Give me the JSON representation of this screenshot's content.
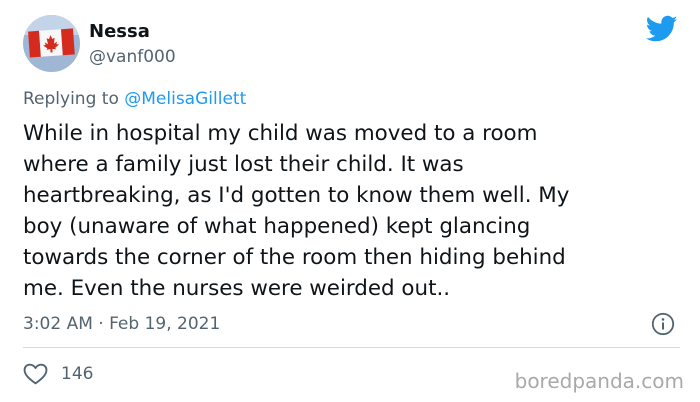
{
  "author": {
    "name": "Nessa",
    "handle": "@vanf000",
    "avatar_icon": "canada-flag-avatar"
  },
  "reply": {
    "prefix": "Replying to",
    "target": "@MelisaGillett"
  },
  "tweet": {
    "lines": [
      "While in hospital my child was moved to a room",
      "where a family just lost their child. It was",
      "heartbreaking, as I'd gotten to know them well. My",
      "boy (unaware of what happened) kept glancing",
      "towards the corner of the room then hiding behind",
      "me. Even the nurses were weirded out.."
    ]
  },
  "meta": {
    "timestamp": "3:02 AM · Feb 19, 2021"
  },
  "actions": {
    "like_count": "146"
  },
  "watermark": "boredpanda.com",
  "icons": {
    "brand": "twitter-bird-icon",
    "info": "info-icon",
    "like": "heart-icon"
  },
  "colors": {
    "twitter_blue": "#1d9bf0",
    "secondary_text": "#536471",
    "primary_text": "#0f1419",
    "flag_red": "#d52b1e",
    "watermark": "#a9a9a9"
  }
}
